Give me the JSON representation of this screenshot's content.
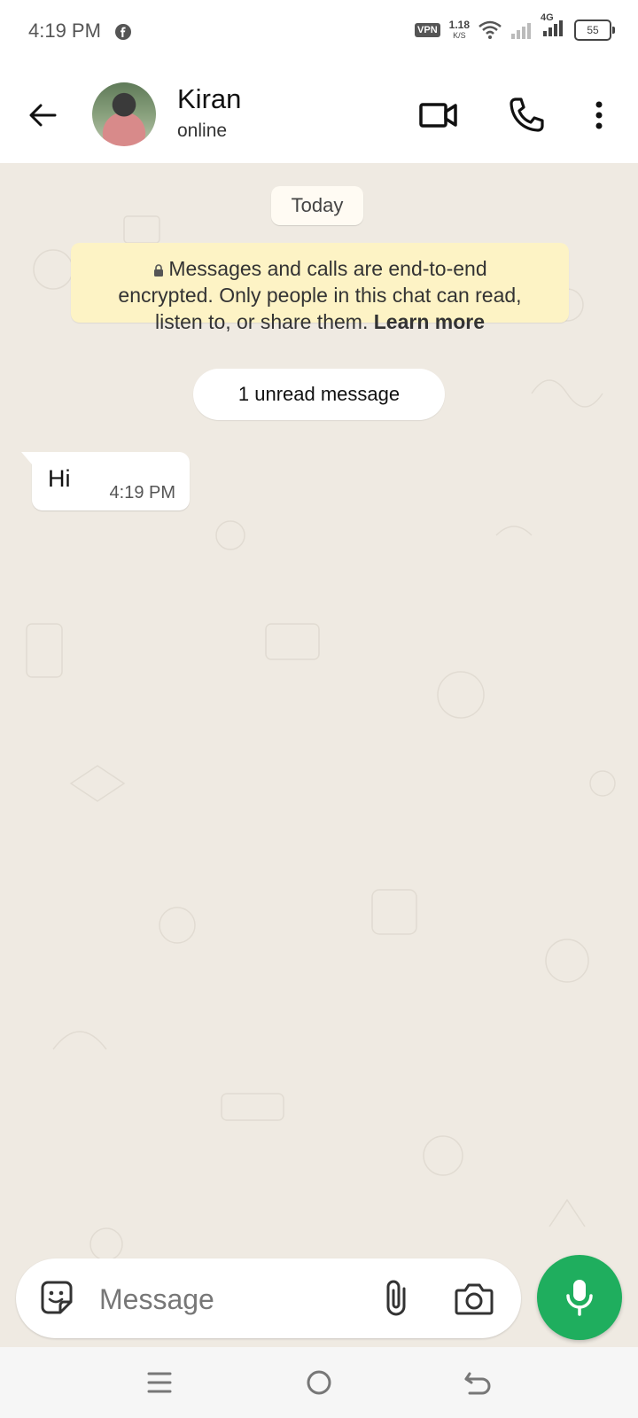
{
  "status_bar": {
    "time": "4:19 PM",
    "vpn_label": "VPN",
    "net_speed_value": "1.18",
    "net_speed_unit": "K/S",
    "network_type": "4G",
    "battery_level": "55",
    "icons": [
      "facebook-icon",
      "wifi-icon",
      "signal-icon",
      "battery-icon"
    ]
  },
  "header": {
    "contact_name": "Kiran",
    "contact_status": "online",
    "icons": [
      "back-arrow-icon",
      "video-call-icon",
      "phone-icon",
      "more-vert-icon"
    ]
  },
  "chat": {
    "date_chip": "Today",
    "encryption_notice": {
      "line1": "Messages and calls are end-to-end",
      "line2": "encrypted. Only people in this chat can read,",
      "line3": "listen to, or share them.",
      "link": "Learn more"
    },
    "unread_chip": "1 unread message",
    "messages": [
      {
        "text": "Hi",
        "time": "4:19 PM",
        "direction": "incoming"
      }
    ]
  },
  "composer": {
    "placeholder": "Message",
    "icons": [
      "emoji-sticker-icon",
      "attach-icon",
      "camera-icon",
      "mic-icon"
    ]
  },
  "nav_bar": {
    "icons": [
      "menu-lines-icon",
      "home-circle-icon",
      "back-icon"
    ]
  },
  "colors": {
    "chat_background": "#efeae2",
    "encryption_notice_bg": "#fdf3c5",
    "mic_button": "#1fae5e"
  }
}
